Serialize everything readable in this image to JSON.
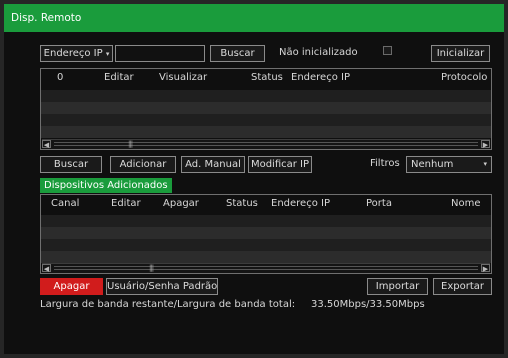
{
  "window": {
    "title": "Disp. Remoto"
  },
  "search_bar": {
    "filter_label": "Endereço IP",
    "filter_icon": "dropdown-arrow-icon",
    "input_value": "",
    "search_label": "Buscar",
    "uninitialized_label": "Não inicializado",
    "uninitialized_checked": false,
    "initialize_label": "Inicializar"
  },
  "discovered_table": {
    "columns": [
      "0",
      "Editar",
      "Visualizar",
      "Status",
      "Endereço IP",
      "Protocolo"
    ],
    "rows": [],
    "scroll_left_icon": "arrow-left-icon",
    "scroll_right_icon": "arrow-right-icon",
    "scroll_thumb_icon": "scroll-grip-icon"
  },
  "actions": {
    "search_label": "Buscar",
    "add_label": "Adicionar",
    "manual_add_label": "Ad. Manual",
    "modify_ip_label": "Modificar IP",
    "filter_label": "Filtros",
    "filter_value": "Nenhum",
    "filter_icon": "dropdown-arrow-icon"
  },
  "added_section": {
    "title": "Dispositivos Adicionados"
  },
  "added_table": {
    "columns": [
      "Canal",
      "Editar",
      "Apagar",
      "Status",
      "Endereço IP",
      "Porta",
      "Nome"
    ],
    "rows": [],
    "scroll_left_icon": "arrow-left-icon",
    "scroll_right_icon": "arrow-right-icon",
    "scroll_thumb_icon": "scroll-grip-icon"
  },
  "bottom_actions": {
    "delete_label": "Apagar",
    "user_password_label": "Usuário/Senha Padrão",
    "import_label": "Importar",
    "export_label": "Exportar"
  },
  "bandwidth": {
    "label": "Largura de banda restante/Largura de banda total:",
    "value": "33.50Mbps/33.50Mbps"
  },
  "colors": {
    "accent": "#1a9c3c",
    "danger": "#d11c1c",
    "background": "#0f0f0f"
  }
}
